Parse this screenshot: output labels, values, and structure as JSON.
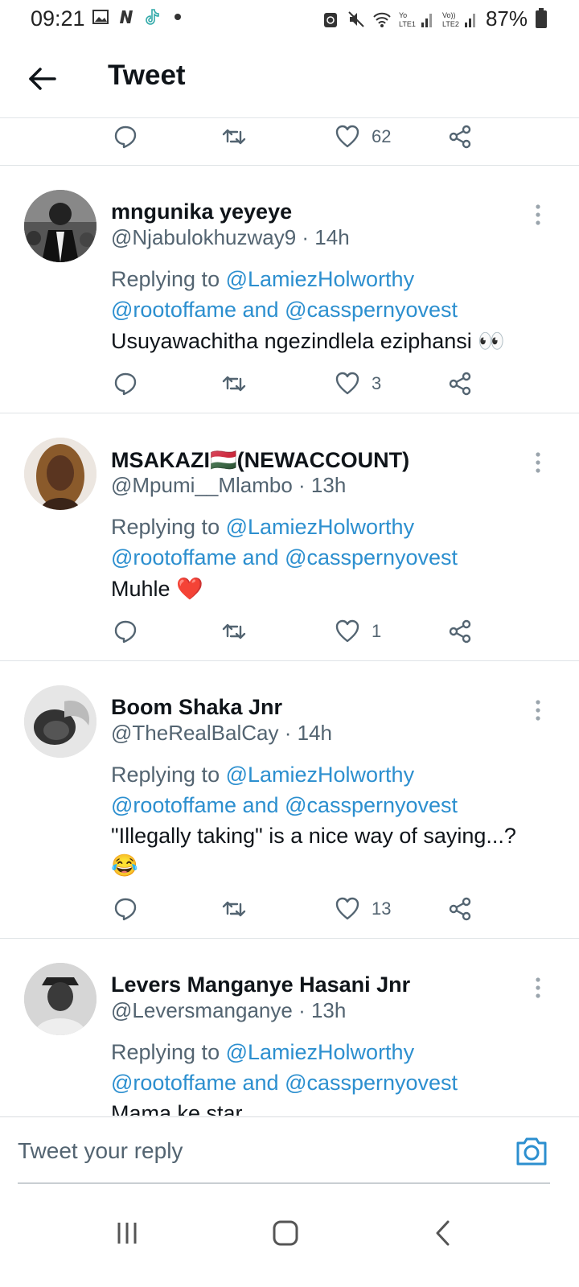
{
  "status_bar": {
    "time": "09:21",
    "battery": "87%",
    "left_icons": [
      "gallery-icon",
      "n-app-icon",
      "tiktok-icon",
      "dot-icon"
    ],
    "right_icons": [
      "recycle-icon",
      "mute-icon",
      "wifi-icon",
      "lte1-signal-icon",
      "lte2-signal-icon",
      "battery-icon"
    ]
  },
  "header": {
    "title": "Tweet"
  },
  "top_actions": {
    "likes": "62"
  },
  "tweets": [
    {
      "name": "mngunika yeyeye",
      "handle": "@Njabulokhuzway9 · 14h",
      "replying_prefix": "Replying to ",
      "replying_to_1": "@LamiezHolworthy",
      "replying_to_2": "@rootoffame",
      "replying_and": " and ",
      "replying_to_3": "@casspernyovest",
      "text": "Usuyawachitha ngezindlela eziphansi 👀",
      "likes": "3"
    },
    {
      "name": "MSAKAZI🇭🇺(NEWACCOUNT)",
      "handle": "@Mpumi__Mlambo · 13h",
      "replying_prefix": "Replying to ",
      "replying_to_1": "@LamiezHolworthy",
      "replying_to_2": "@rootoffame",
      "replying_and": " and ",
      "replying_to_3": "@casspernyovest",
      "text": "Muhle ❤️",
      "likes": "1"
    },
    {
      "name": "Boom Shaka Jnr",
      "handle": "@TheRealBalCay · 14h",
      "replying_prefix": "Replying to ",
      "replying_to_1": "@LamiezHolworthy",
      "replying_to_2": "@rootoffame",
      "replying_and": " and ",
      "replying_to_3": "@casspernyovest",
      "text": "\"Illegally taking\" is a nice way of saying...?",
      "text_line2": "😂",
      "likes": "13"
    },
    {
      "name": "Levers Manganye Hasani Jnr",
      "handle": "@Leversmanganye · 13h",
      "replying_prefix": "Replying to ",
      "replying_to_1": "@LamiezHolworthy",
      "replying_to_2": "@rootoffame",
      "replying_and": " and ",
      "replying_to_3": "@casspernyovest",
      "text": "Mama ke star"
    }
  ],
  "reply_bar": {
    "placeholder": "Tweet your reply"
  },
  "colors": {
    "accent": "#2c8fcf",
    "secondary_text": "#536471",
    "primary_text": "#0f1419"
  }
}
